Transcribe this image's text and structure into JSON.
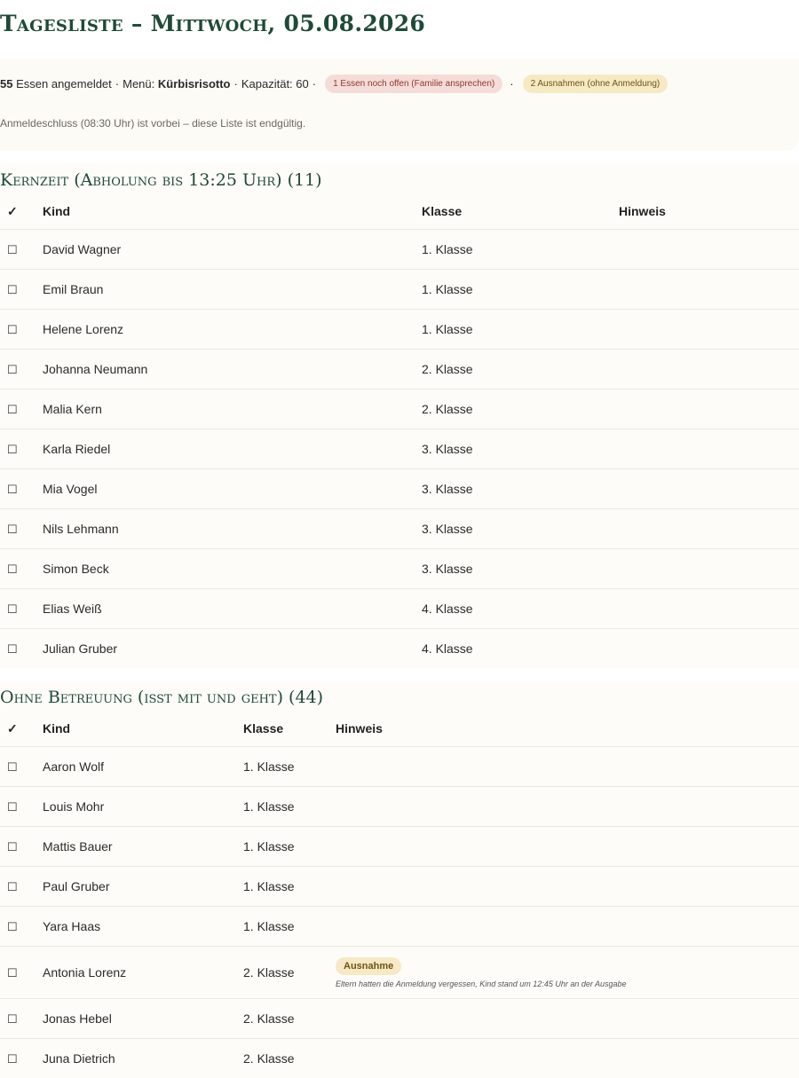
{
  "page": {
    "title": "Tagesliste – Mittwoch, 05.08.2026"
  },
  "summary": {
    "count": "55",
    "count_label": "Essen angemeldet",
    "menu_label": "Menü:",
    "menu_value": "Kürbisrisotto",
    "capacity": "Kapazität: 60",
    "separator": "·",
    "badge_open": "1 Essen noch offen (Familie ansprechen)",
    "badge_exceptions": "2 Ausnahmen (ohne Anmeldung)",
    "note": "Anmeldeschluss (08:30 Uhr) ist vorbei – diese Liste ist endgültig."
  },
  "columns": {
    "check": "✓",
    "kind": "Kind",
    "klasse": "Klasse",
    "hinweis": "Hinweis"
  },
  "checkbox_glyph": "☐",
  "kernzeit": {
    "heading": "Kernzeit (Abholung bis 13:25 Uhr) (11)",
    "rows": [
      {
        "name": "David Wagner",
        "klasse": "1. Klasse",
        "hinweis": ""
      },
      {
        "name": "Emil Braun",
        "klasse": "1. Klasse",
        "hinweis": ""
      },
      {
        "name": "Helene Lorenz",
        "klasse": "1. Klasse",
        "hinweis": ""
      },
      {
        "name": "Johanna Neumann",
        "klasse": "2. Klasse",
        "hinweis": ""
      },
      {
        "name": "Malia Kern",
        "klasse": "2. Klasse",
        "hinweis": ""
      },
      {
        "name": "Karla Riedel",
        "klasse": "3. Klasse",
        "hinweis": ""
      },
      {
        "name": "Mia Vogel",
        "klasse": "3. Klasse",
        "hinweis": ""
      },
      {
        "name": "Nils Lehmann",
        "klasse": "3. Klasse",
        "hinweis": ""
      },
      {
        "name": "Simon Beck",
        "klasse": "3. Klasse",
        "hinweis": ""
      },
      {
        "name": "Elias Weiß",
        "klasse": "4. Klasse",
        "hinweis": ""
      },
      {
        "name": "Julian Gruber",
        "klasse": "4. Klasse",
        "hinweis": ""
      }
    ]
  },
  "ohne": {
    "heading": "Ohne Betreuung (isst mit und geht) (44)",
    "rows": [
      {
        "name": "Aaron Wolf",
        "klasse": "1. Klasse"
      },
      {
        "name": "Louis Mohr",
        "klasse": "1. Klasse"
      },
      {
        "name": "Mattis Bauer",
        "klasse": "1. Klasse"
      },
      {
        "name": "Paul Gruber",
        "klasse": "1. Klasse"
      },
      {
        "name": "Yara Haas",
        "klasse": "1. Klasse"
      },
      {
        "name": "Antonia Lorenz",
        "klasse": "2. Klasse",
        "badge": "Ausnahme",
        "note": "Eltern hatten die Anmeldung vergessen, Kind stand um 12:45 Uhr an der Ausgabe"
      },
      {
        "name": "Jonas Hebel",
        "klasse": "2. Klasse"
      },
      {
        "name": "Juna Dietrich",
        "klasse": "2. Klasse"
      }
    ]
  }
}
